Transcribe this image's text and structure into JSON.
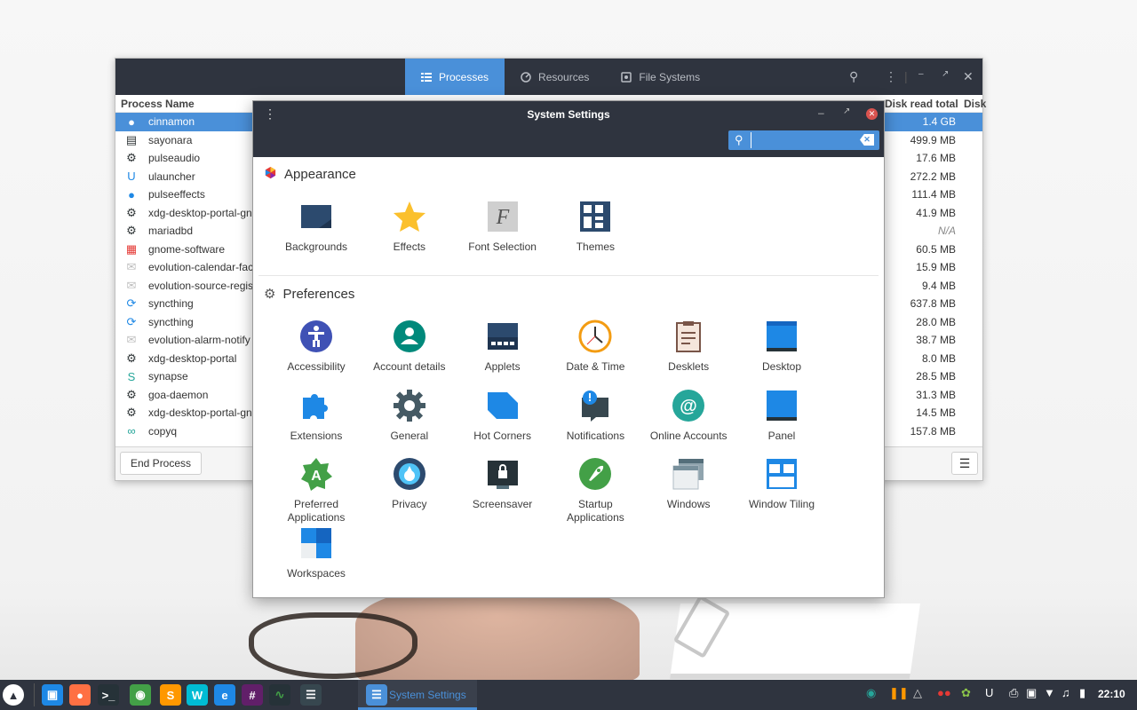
{
  "system_monitor": {
    "tabs": [
      {
        "label": "Processes",
        "icon": "list-icon",
        "active": true
      },
      {
        "label": "Resources",
        "icon": "gauge-icon",
        "active": false
      },
      {
        "label": "File Systems",
        "icon": "disk-icon",
        "active": false
      }
    ],
    "columns": {
      "name": "Process Name",
      "disk_read": "Disk read total",
      "disk_write": "Disk"
    },
    "processes": [
      {
        "name": "cinnamon",
        "disk_read": "1.4 GB",
        "icon": "cinnamon-icon",
        "icon_color": "#e06c3c",
        "selected": true
      },
      {
        "name": "sayonara",
        "disk_read": "499.9 MB",
        "icon": "list-icon",
        "icon_color": "#2e3436"
      },
      {
        "name": "pulseaudio",
        "disk_read": "17.6 MB",
        "icon": "gear-icon",
        "icon_color": "#2e3436"
      },
      {
        "name": "ulauncher",
        "disk_read": "272.2 MB",
        "icon": "ulauncher-icon",
        "icon_color": "#1e88e5"
      },
      {
        "name": "pulseeffects",
        "disk_read": "111.4 MB",
        "icon": "pulseeffects-icon",
        "icon_color": "#1e88e5"
      },
      {
        "name": "xdg-desktop-portal-gno",
        "disk_read": "41.9 MB",
        "icon": "gear-icon",
        "icon_color": "#2e3436"
      },
      {
        "name": "mariadbd",
        "disk_read": "N/A",
        "icon": "gear-icon",
        "icon_color": "#2e3436"
      },
      {
        "name": "gnome-software",
        "disk_read": "60.5 MB",
        "icon": "gnome-software-icon",
        "icon_color": "#e53935"
      },
      {
        "name": "evolution-calendar-facto",
        "disk_read": "15.9 MB",
        "icon": "envelope-icon",
        "icon_color": "#bdbdbd"
      },
      {
        "name": "evolution-source-registr",
        "disk_read": "9.4 MB",
        "icon": "envelope-icon",
        "icon_color": "#bdbdbd"
      },
      {
        "name": "syncthing",
        "disk_read": "637.8 MB",
        "icon": "syncthing-icon",
        "icon_color": "#1e88e5"
      },
      {
        "name": "syncthing",
        "disk_read": "28.0 MB",
        "icon": "syncthing-icon",
        "icon_color": "#1e88e5"
      },
      {
        "name": "evolution-alarm-notify",
        "disk_read": "38.7 MB",
        "icon": "envelope-icon",
        "icon_color": "#bdbdbd"
      },
      {
        "name": "xdg-desktop-portal",
        "disk_read": "8.0 MB",
        "icon": "gear-icon",
        "icon_color": "#2e3436"
      },
      {
        "name": "synapse",
        "disk_read": "28.5 MB",
        "icon": "synapse-icon",
        "icon_color": "#26a69a"
      },
      {
        "name": "goa-daemon",
        "disk_read": "31.3 MB",
        "icon": "gear-icon",
        "icon_color": "#2e3436"
      },
      {
        "name": "xdg-desktop-portal-gno",
        "disk_read": "14.5 MB",
        "icon": "gear-icon",
        "icon_color": "#2e3436"
      },
      {
        "name": "copyq",
        "disk_read": "157.8 MB",
        "icon": "copyq-icon",
        "icon_color": "#26a69a"
      }
    ],
    "end_process_label": "End Process"
  },
  "settings": {
    "title": "System Settings",
    "search_value": "",
    "sections": [
      {
        "title": "Appearance",
        "items": [
          {
            "label": "Backgrounds",
            "icon": "backgrounds-icon"
          },
          {
            "label": "Effects",
            "icon": "effects-icon"
          },
          {
            "label": "Font Selection",
            "icon": "font-selection-icon"
          },
          {
            "label": "Themes",
            "icon": "themes-icon"
          }
        ]
      },
      {
        "title": "Preferences",
        "items": [
          {
            "label": "Accessibility",
            "icon": "accessibility-icon"
          },
          {
            "label": "Account details",
            "icon": "account-icon"
          },
          {
            "label": "Applets",
            "icon": "applets-icon"
          },
          {
            "label": "Date & Time",
            "icon": "clock-icon"
          },
          {
            "label": "Desklets",
            "icon": "desklets-icon"
          },
          {
            "label": "Desktop",
            "icon": "desktop-icon"
          },
          {
            "label": "Extensions",
            "icon": "puzzle-icon"
          },
          {
            "label": "General",
            "icon": "gear-icon"
          },
          {
            "label": "Hot Corners",
            "icon": "hot-corners-icon"
          },
          {
            "label": "Notifications",
            "icon": "notifications-icon"
          },
          {
            "label": "Online Accounts",
            "icon": "online-accounts-icon"
          },
          {
            "label": "Panel",
            "icon": "panel-icon"
          },
          {
            "label": "Preferred Applications",
            "icon": "preferred-apps-icon"
          },
          {
            "label": "Privacy",
            "icon": "privacy-icon"
          },
          {
            "label": "Screensaver",
            "icon": "screensaver-icon"
          },
          {
            "label": "Startup Applications",
            "icon": "startup-icon"
          },
          {
            "label": "Windows",
            "icon": "windows-icon"
          },
          {
            "label": "Window Tiling",
            "icon": "window-tiling-icon"
          },
          {
            "label": "Workspaces",
            "icon": "workspaces-icon"
          }
        ]
      }
    ]
  },
  "taskbar": {
    "active_window": "System Settings",
    "clock": "22:10",
    "accent": "#4a90d9",
    "launchers": [
      "menu-icon",
      "files-icon",
      "firefox-icon",
      "terminal-icon",
      "chrome-icon",
      "sublime-icon",
      "webstorm-icon",
      "edge-dev-icon",
      "slack-icon",
      "system-monitor-icon",
      "sayonara-icon"
    ],
    "tray": [
      "synapse-icon",
      "pause-icon",
      "vpn-icon",
      "cherries-icon",
      "syncthing-tray-icon",
      "ulauncher-tray-icon",
      "printer-icon",
      "removable-drive-icon",
      "wifi-icon",
      "music-icon",
      "battery-icon"
    ]
  }
}
